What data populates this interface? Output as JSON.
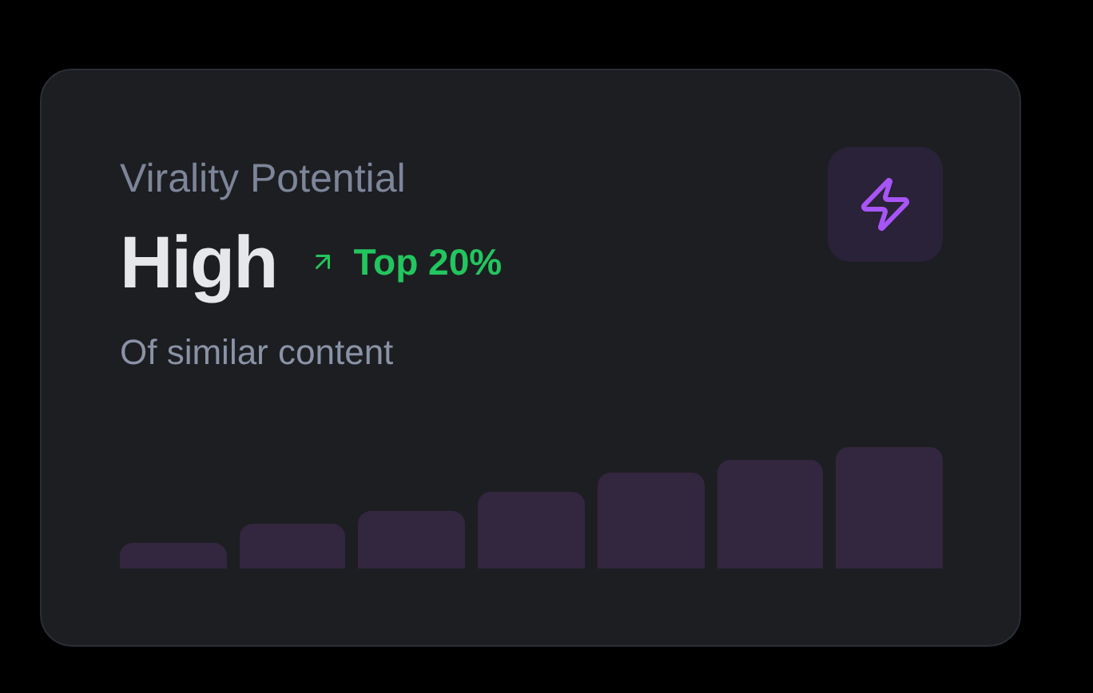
{
  "card": {
    "title": "Virality Potential",
    "value": "High",
    "trend": {
      "up": true,
      "label": "Top 20%"
    },
    "subtitle": "Of similar content"
  }
}
